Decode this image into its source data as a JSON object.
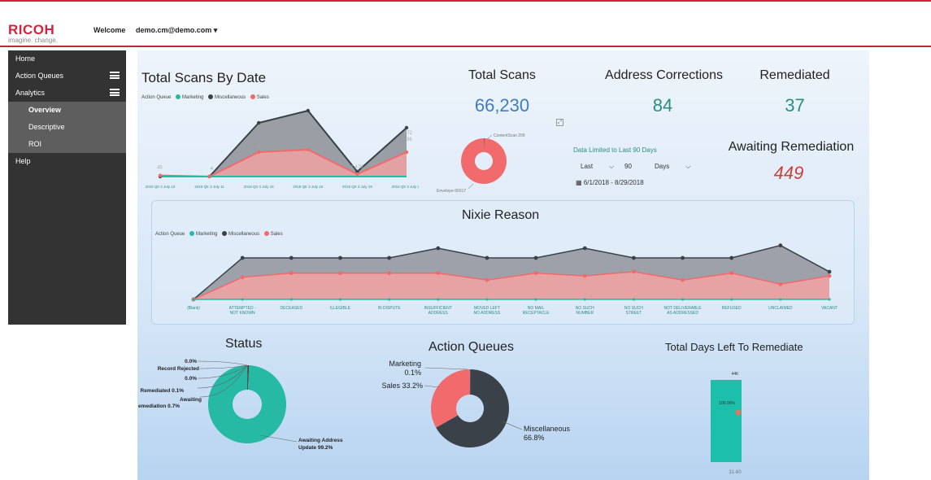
{
  "header": {
    "logo": "RICOH",
    "logo_tagline": "imagine. change.",
    "welcome": "Welcome",
    "user": "demo.cm@demo.com ▾"
  },
  "sidebar": {
    "items": [
      {
        "label": "Home"
      },
      {
        "label": "Action Queues"
      },
      {
        "label": "Analytics"
      },
      {
        "label": "Overview"
      },
      {
        "label": "Descriptive"
      },
      {
        "label": "ROI"
      },
      {
        "label": "Help"
      }
    ]
  },
  "colors": {
    "brand": "#d6233b",
    "marketing": "#26b9a4",
    "miscellaneous": "#3a4149",
    "sales": "#f16a6c",
    "kpi_blue": "#3f7cc2",
    "kpi_teal": "#2a8d85",
    "kpi_red": "#c9433c"
  },
  "kpis": {
    "total_scans_title": "Total Scans",
    "total_scans": "66,230",
    "address_corrections_title": "Address Corrections",
    "address_corrections": "84",
    "remediated_title": "Remediated",
    "remediated": "37",
    "awaiting_title": "Awaiting Remediation",
    "awaiting": "449"
  },
  "filter": {
    "heading": "Data Limited to Last 90 Days",
    "mode": "Last",
    "value": "90",
    "unit": "Days",
    "range": "6/1/2018 - 8/29/2018"
  },
  "chart_data": [
    {
      "type": "area",
      "title": "Total Scans By Date",
      "legend_title": "Action Queue",
      "legend": [
        "Marketing",
        "Miscellaneous",
        "Sales"
      ],
      "categories": [
        "2018 Qtr 3 July 10",
        "2018 Qtr 3 July 11",
        "2018 Qtr 3 July 16",
        "2018 Qtr 3 July 18",
        "2018 Qtr 3 July 19",
        "2018 Qtr 3 July 27"
      ],
      "series": [
        {
          "name": "Marketing",
          "values": [
            0,
            0,
            1,
            0,
            0,
            0
          ]
        },
        {
          "name": "Miscellaneous",
          "values": [
            0,
            0,
            2200,
            2700,
            200,
            2000
          ]
        },
        {
          "name": "Sales",
          "values": [
            45,
            4,
            1000,
            1100,
            100,
            1000
          ]
        }
      ],
      "labels": [
        "45",
        "4",
        "1",
        "1,470",
        "572",
        "36"
      ],
      "ylim": [
        0,
        2800
      ]
    },
    {
      "type": "pie",
      "subtype": "donut",
      "title": "",
      "labels": [
        "ContentScan 209",
        "Envelope 66017"
      ],
      "values": [
        209,
        66017
      ]
    },
    {
      "type": "line",
      "title": "Nixie Reason",
      "legend_title": "Action Queue",
      "legend": [
        "Marketing",
        "Miscellaneous",
        "Sales"
      ],
      "categories": [
        "(Blank)",
        "ATTEMPTED - NOT KNOWN",
        "DECEASED",
        "ILLEGIBLE",
        "IN DISPUTE",
        "INSUFFICIENT ADDRESS",
        "MOVED LEFT NO ADDRESS",
        "NO MAIL RECEPTACLE",
        "NO SUCH NUMBER",
        "NO SUCH STREET",
        "NOT DELIVERABLE AS ADDRESSED",
        "REFUSED",
        "UNCLAIMED",
        "VACANT"
      ],
      "series": [
        {
          "name": "Marketing",
          "values": [
            0,
            0,
            0,
            0,
            0,
            0,
            0,
            0,
            0,
            0,
            0,
            0,
            0,
            0
          ]
        },
        {
          "name": "Miscellaneous",
          "values": [
            0,
            3,
            3,
            3,
            3,
            3.7,
            3,
            3,
            3.7,
            3,
            3,
            3,
            3.9,
            2
          ]
        },
        {
          "name": "Sales",
          "values": [
            0,
            1.6,
            1.9,
            1.9,
            1.9,
            1.9,
            1.4,
            1.9,
            1.7,
            2,
            1.4,
            1.9,
            1.1,
            1.7
          ]
        }
      ]
    },
    {
      "type": "pie",
      "subtype": "donut",
      "title": "Status",
      "labels": [
        "0.0%",
        "Record Rejected",
        "0.0%",
        "Remediated 0.1%",
        "Awaiting",
        "Remediation 0.7%",
        "Awaiting Address",
        "Update 99.2%"
      ],
      "values": [
        0,
        0,
        0.1,
        0.7,
        99.2
      ]
    },
    {
      "type": "pie",
      "subtype": "donut",
      "title": "Action Queues",
      "labels": [
        "Marketing",
        "0.1%",
        "Sales 33.2%",
        "Miscellaneous",
        "66.8%"
      ],
      "values": [
        0.1,
        33.2,
        66.8
      ]
    },
    {
      "type": "bar",
      "title": "Total Days Left To Remediate",
      "categories": [
        "31-60"
      ],
      "values": [
        100
      ],
      "labels": [
        "44K",
        "100.00%"
      ]
    }
  ]
}
